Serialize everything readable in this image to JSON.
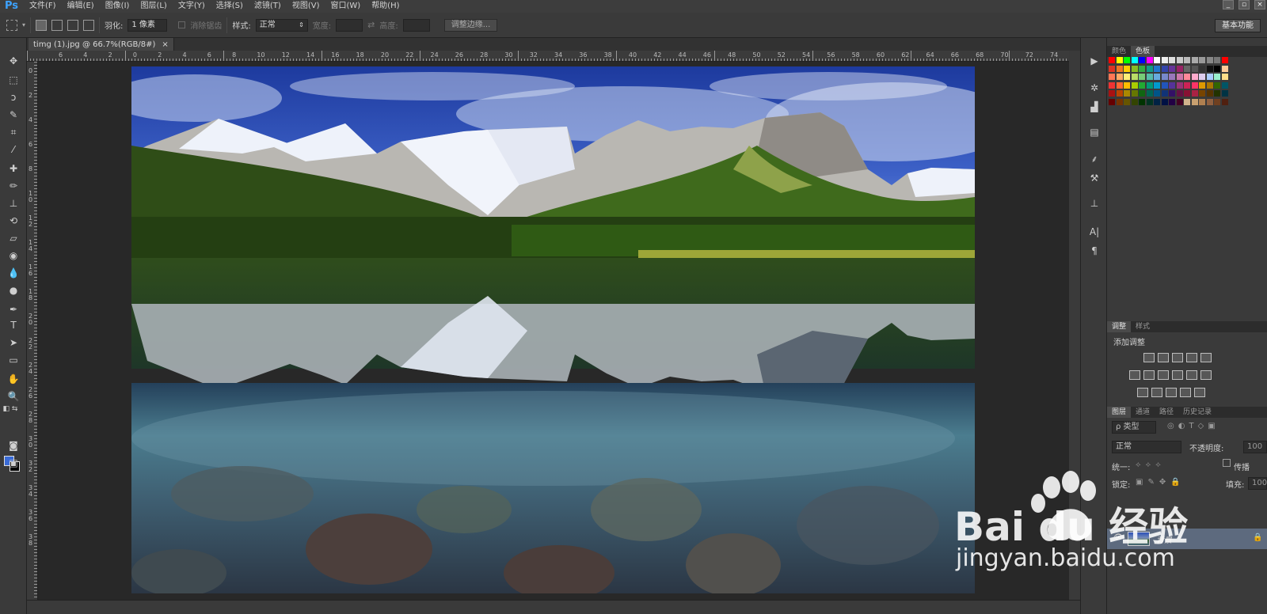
{
  "app": {
    "logo": "Ps"
  },
  "menu": [
    "文件(F)",
    "编辑(E)",
    "图像(I)",
    "图层(L)",
    "文字(Y)",
    "选择(S)",
    "滤镜(T)",
    "视图(V)",
    "窗口(W)",
    "帮助(H)"
  ],
  "window_controls": [
    "_",
    "▫",
    "×"
  ],
  "options": {
    "feather_label": "羽化:",
    "feather_value": "1 像素",
    "antialias_label": "消除锯齿",
    "style_label": "样式:",
    "style_value": "正常",
    "width_label": "宽度:",
    "height_label": "高度:",
    "refine_button": "调整边缘..."
  },
  "workspace": "基本功能",
  "document": {
    "tab_title": "timg (1).jpg @ 66.7%(RGB/8#)",
    "close": "×"
  },
  "ruler": {
    "h_labels": [
      "6",
      "4",
      "2",
      "0",
      "2",
      "4",
      "6",
      "8",
      "10",
      "12",
      "14",
      "16",
      "18",
      "20",
      "22",
      "24",
      "26",
      "28",
      "30",
      "32",
      "34",
      "36",
      "38",
      "40",
      "42",
      "44",
      "46",
      "48",
      "50",
      "52",
      "54",
      "56",
      "58",
      "60",
      "62",
      "64",
      "66",
      "68",
      "70",
      "72",
      "74"
    ],
    "v_labels": [
      "0",
      "2",
      "4",
      "6",
      "8",
      "1 0",
      "1 2",
      "1 4",
      "1 6",
      "1 8",
      "2 0",
      "2 2",
      "2 4",
      "2 6",
      "2 8",
      "3 0",
      "3 2",
      "3 4",
      "3 6",
      "3 8"
    ]
  },
  "color_panel": {
    "tabs": [
      "颜色",
      "色板"
    ],
    "active": 1
  },
  "adjust_panel": {
    "tabs": [
      "调整",
      "样式"
    ],
    "active": 0,
    "title": "添加调整"
  },
  "layers_panel": {
    "tabs": [
      "图层",
      "通道",
      "路径",
      "历史记录"
    ],
    "active": 0,
    "filter_label": "ρ 类型",
    "blend_mode": "正常",
    "opacity_label": "不透明度:",
    "opacity_value": "100",
    "unify_label": "统一:",
    "propagate_label": "传播",
    "lock_label": "锁定:",
    "fill_label": "填充:",
    "fill_value": "100",
    "layer_name": "背景"
  },
  "watermark": {
    "text": "Bai du 经验",
    "url": "jingyan.baidu.com"
  }
}
